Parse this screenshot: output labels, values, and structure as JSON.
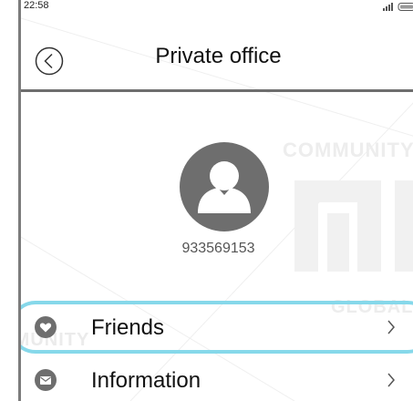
{
  "status_bar": {
    "time": "22:58",
    "signal_icon": "signal-icon",
    "battery_icon": "battery-icon"
  },
  "header": {
    "title": "Private office",
    "back_icon": "back-arrow-icon"
  },
  "profile": {
    "avatar_icon": "user-avatar-icon",
    "user_id": "933569153"
  },
  "menu": {
    "items": [
      {
        "label": "Friends",
        "icon": "heart-icon"
      },
      {
        "label": "Information",
        "icon": "envelope-icon"
      }
    ],
    "highlighted_item": "Friends"
  },
  "watermark": {
    "community": "COMMUNITY",
    "global": "GLOBAL",
    "community_bottom": "MMUNITY"
  },
  "colors": {
    "icon_gray": "#6e6e6e",
    "highlight": "#86d8ea",
    "text": "#111111"
  }
}
